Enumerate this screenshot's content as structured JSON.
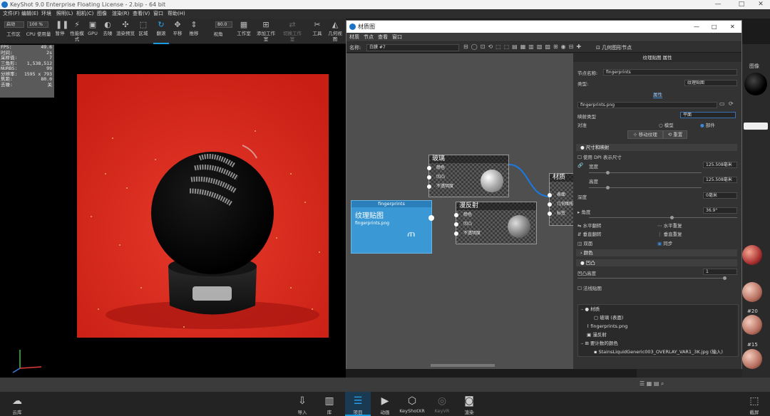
{
  "window": {
    "title": "KeyShot 9.0 Enterprise Floating License - 2.bip - 64 bit",
    "controls": [
      "—",
      "□",
      "✕"
    ]
  },
  "menu": [
    "文件(F)",
    "编辑(E)",
    "环境",
    "照明(L)",
    "相机(C)",
    "图像",
    "渲染(R)",
    "查看(V)",
    "窗口",
    "帮助(H)"
  ],
  "toolbar": {
    "preset_value": "启动",
    "zoom_value": "100 %",
    "angle_value": "80.0",
    "items": [
      "工作区",
      "CPU 使用量",
      "暂停",
      "性能模式",
      "GPU",
      "去噪",
      "渲染预览",
      "区域",
      "翻滚",
      "平移",
      "推移",
      "视角",
      "工作室",
      "添加工作室",
      "切换工作室",
      "工具",
      "几何视图"
    ]
  },
  "hud": [
    {
      "k": "FPS:",
      "v": "49.6"
    },
    {
      "k": "时间:",
      "v": "2s"
    },
    {
      "k": "采样值:",
      "v": "7"
    },
    {
      "k": "三角形:",
      "v": "1,538,512"
    },
    {
      "k": "NURBS:",
      "v": "99"
    },
    {
      "k": "分辨率:",
      "v": "1595 x 793"
    },
    {
      "k": "焦距:",
      "v": "80.0"
    },
    {
      "k": "去噪:",
      "v": "关"
    }
  ],
  "dock": [
    "云库",
    "导入",
    "库",
    "项目",
    "动画",
    "KeyShotXR",
    "KeyVR",
    "渲染",
    "截屏"
  ],
  "material_window": {
    "title": "材质图",
    "controls": [
      "—",
      "□",
      "✕"
    ],
    "menu": [
      "材质",
      "节点",
      "查看",
      "窗口"
    ],
    "name_label": "名称:",
    "name_value": "白膜 #7",
    "geometry_node_button": "几何图形节点",
    "nodes": {
      "glass": {
        "title": "玻璃",
        "ports": [
          "颜色",
          "凹凸",
          "不透明度"
        ]
      },
      "diffuse": {
        "title": "漫反射",
        "ports": [
          "颜色",
          "凹凸",
          "不透明度"
        ]
      },
      "material": {
        "title": "材质",
        "ports": [
          "表面",
          "几何图形",
          "标签"
        ]
      },
      "texture": {
        "header": "fingerprints",
        "title": "纹理贴图",
        "file": "fingerprints.png"
      }
    },
    "panel": {
      "header": "纹理贴图 属性",
      "node_name_label": "节点名称:",
      "node_name_value": "fingerprints",
      "type_label": "类型:",
      "type_value": "纹理贴图",
      "tab_properties": "属性",
      "file_value": "fingerprints.png",
      "mapping_label": "映射类型",
      "mapping_value": "平面",
      "align_label": "对准",
      "align_options": [
        "模型",
        "部件"
      ],
      "move_texture": "移动纹理",
      "reset": "重置",
      "section_size": "尺寸和映射",
      "use_dpi": "使用 DPI 表示尺寸",
      "width_label": "宽度",
      "width_value": "125.508毫米",
      "height_label": "高度",
      "height_value": "125.508毫米",
      "depth_label": "深度",
      "depth_value": "0毫米",
      "angle_label": "角度",
      "angle_value": "36.9°",
      "flip_h": "水平翻转",
      "repeat_h": "水平重复",
      "flip_v": "垂直翻转",
      "repeat_v": "垂直重复",
      "two_sided": "双面",
      "sync": "同步",
      "section_color": "颜色",
      "section_bump": "凹凸",
      "bump_height_label": "凹凸高度",
      "bump_height_value": "1",
      "normal_map": "法线贴图",
      "tree": [
        "材质",
        "玻璃 (表面)",
        "fingerprints.png",
        "漫反射",
        "要计数的颜色",
        "StainsLiquidGeneric003_OVERLAY_VAR1_3K.jpg (输入)"
      ]
    }
  },
  "right_panel": {
    "label": "图像",
    "library_labels": [
      "#20",
      "#15"
    ]
  }
}
